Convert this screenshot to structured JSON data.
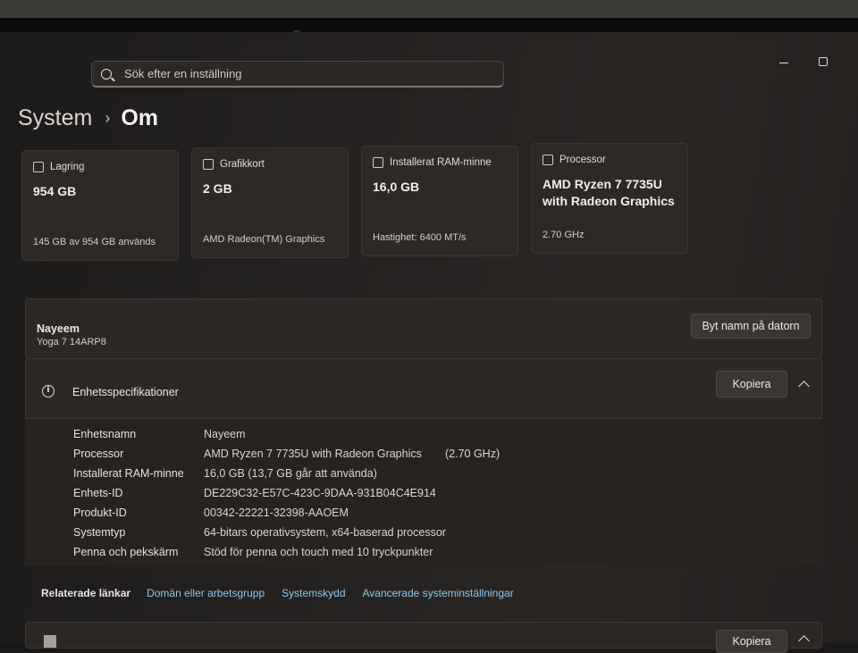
{
  "search": {
    "placeholder": "Sök efter en inställning"
  },
  "breadcrumb": {
    "parent": "System",
    "separator": "›",
    "current": "Om"
  },
  "cards": [
    {
      "title": "Lagring",
      "value": "954 GB",
      "sub": "145 GB av 954 GB används",
      "icon": "storage-icon"
    },
    {
      "title": "Grafikkort",
      "value": "2 GB",
      "sub": "AMD Radeon(TM) Graphics",
      "icon": "gpu-icon"
    },
    {
      "title": "Installerat RAM-minne",
      "value": "16,0 GB",
      "sub": "Hastighet: 6400 MT/s",
      "icon": "ram-icon"
    },
    {
      "title": "Processor",
      "value": "AMD Ryzen 7 7735U with Radeon Graphics",
      "sub": "2.70 GHz",
      "icon": "cpu-icon"
    }
  ],
  "device": {
    "name": "Nayeem",
    "model": "Yoga 7 14ARP8",
    "rename_label": "Byt namn på datorn"
  },
  "specs": {
    "title": "Enhetsspecifikationer",
    "copy_label": "Kopiera",
    "rows": [
      {
        "label": "Enhetsnamn",
        "value": "Nayeem"
      },
      {
        "label": "Processor",
        "value": "AMD Ryzen 7 7735U with Radeon Graphics",
        "extra": "(2.70 GHz)"
      },
      {
        "label": "Installerat RAM-minne",
        "value": "16,0 GB (13,7 GB går att använda)"
      },
      {
        "label": "Enhets-ID",
        "value": "DE229C32-E57C-423C-9DAA-931B04C4E914"
      },
      {
        "label": "Produkt-ID",
        "value": "00342-22221-32398-AAOEM"
      },
      {
        "label": "Systemtyp",
        "value": "64-bitars operativsystem, x64-baserad processor"
      },
      {
        "label": "Penna och pekskärm",
        "value": "Stöd för penna och touch med 10 tryckpunkter"
      }
    ]
  },
  "related": {
    "label": "Relaterade länkar",
    "links": [
      "Domän eller arbetsgrupp",
      "Systemskydd",
      "Avancerade systeminställningar"
    ]
  },
  "next_section": {
    "copy_label": "Kopiera"
  },
  "colors": {
    "link": "#8ec7ee",
    "background": "#1b1918",
    "card": "#2c2927"
  }
}
